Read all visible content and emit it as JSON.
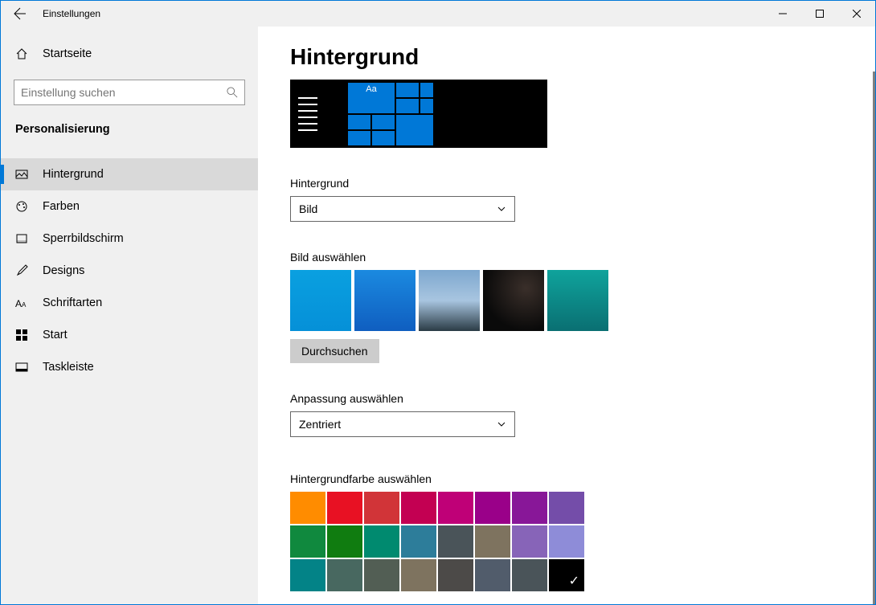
{
  "window": {
    "title": "Einstellungen"
  },
  "sidebar": {
    "home": "Startseite",
    "search_placeholder": "Einstellung suchen",
    "section": "Personalisierung",
    "items": [
      {
        "label": "Hintergrund",
        "active": true
      },
      {
        "label": "Farben"
      },
      {
        "label": "Sperrbildschirm"
      },
      {
        "label": "Designs"
      },
      {
        "label": "Schriftarten"
      },
      {
        "label": "Start"
      },
      {
        "label": "Taskleiste"
      }
    ]
  },
  "main": {
    "title": "Hintergrund",
    "preview_text": "Aa",
    "bg_label": "Hintergrund",
    "bg_value": "Bild",
    "pick_label": "Bild auswählen",
    "browse": "Durchsuchen",
    "fit_label": "Anpassung auswählen",
    "fit_value": "Zentriert",
    "color_label": "Hintergrundfarbe auswählen",
    "colors_row1": [
      "#ff8c00",
      "#e81123",
      "#d13438",
      "#c30052",
      "#bf0077",
      "#9a0089",
      "#881798",
      "#744da9"
    ],
    "colors_row2": [
      "#10893e",
      "#107c10",
      "#008a6f",
      "#2d7d9a",
      "#4a5459",
      "#7e735f",
      "#8764b8",
      "#8e8cd8"
    ],
    "colors_row3": [
      "#038387",
      "#486860",
      "#525e54",
      "#7e735f",
      "#4c4a48",
      "#515c6b",
      "#4a5459",
      "#000000"
    ],
    "selected_color_index": 23
  }
}
